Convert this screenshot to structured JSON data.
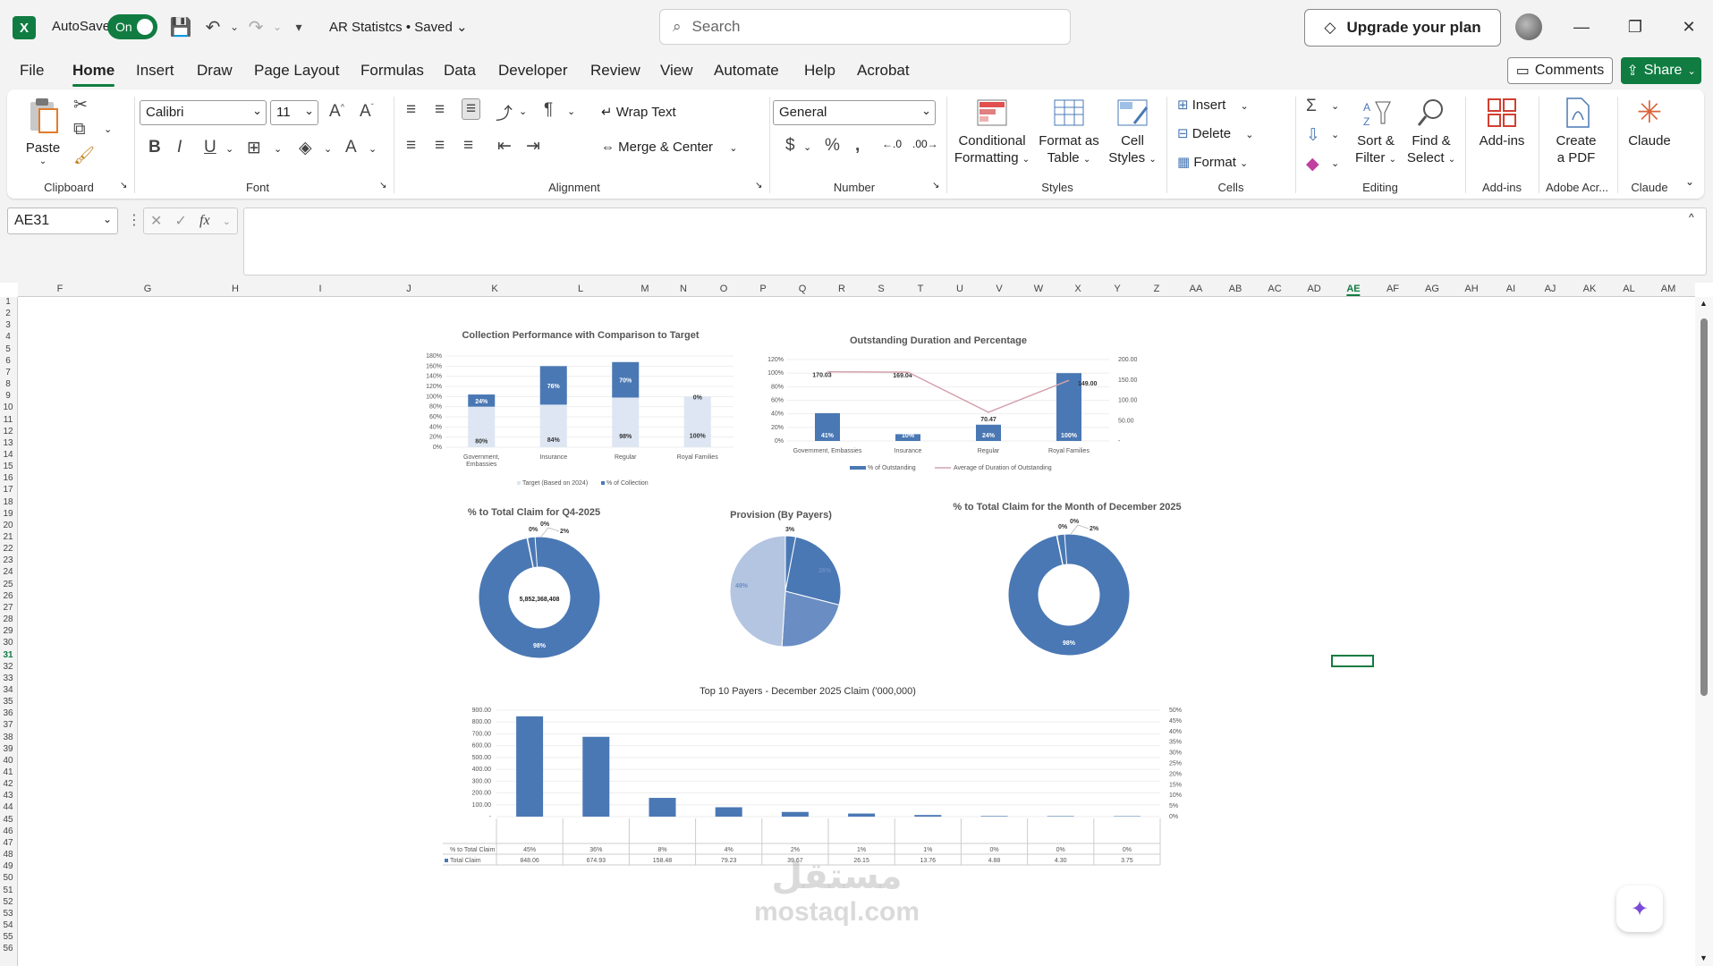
{
  "titlebar": {
    "app_initial": "X",
    "autosave_label": "AutoSave",
    "autosave_state": "On",
    "doc_title": "AR Statistcs • Saved",
    "search_placeholder": "Search",
    "upgrade_label": "Upgrade your plan"
  },
  "menu": {
    "tabs": [
      "File",
      "Home",
      "Insert",
      "Draw",
      "Page Layout",
      "Formulas",
      "Data",
      "Developer",
      "Review",
      "View",
      "Automate",
      "Help",
      "Acrobat"
    ],
    "active": "Home",
    "comments_label": "Comments",
    "share_label": "Share"
  },
  "ribbon": {
    "clipboard": {
      "paste": "Paste",
      "label": "Clipboard"
    },
    "font": {
      "name": "Calibri",
      "size": "11",
      "label": "Font"
    },
    "alignment": {
      "wrap": "Wrap Text",
      "merge": "Merge & Center",
      "label": "Alignment"
    },
    "number": {
      "format": "General",
      "label": "Number"
    },
    "styles": {
      "conditional": [
        "Conditional",
        "Formatting"
      ],
      "format_table": [
        "Format as",
        "Table"
      ],
      "cell_styles": [
        "Cell",
        "Styles"
      ],
      "label": "Styles"
    },
    "cells": {
      "insert": "Insert",
      "delete": "Delete",
      "format": "Format",
      "label": "Cells"
    },
    "editing": {
      "sort": [
        "Sort &",
        "Filter"
      ],
      "find": [
        "Find &",
        "Select"
      ],
      "label": "Editing"
    },
    "addins": {
      "btn": "Add-ins",
      "label": "Add-ins"
    },
    "acrobat": {
      "btn": [
        "Create",
        "a PDF"
      ],
      "label": "Adobe Acr..."
    },
    "claude": {
      "btn": "Claude",
      "label": "Claude"
    }
  },
  "formula_bar": {
    "name_box": "AE31",
    "fx": "fx"
  },
  "grid": {
    "columns": [
      "F",
      "G",
      "H",
      "I",
      "J",
      "K",
      "L",
      "M",
      "N",
      "O",
      "P",
      "Q",
      "R",
      "S",
      "T",
      "U",
      "V",
      "W",
      "X",
      "Y",
      "Z",
      "AA",
      "AB",
      "AC",
      "AD",
      "AE",
      "AF",
      "AG",
      "AH",
      "AI",
      "AJ",
      "AK",
      "AL",
      "AM"
    ],
    "selected_column": "AE",
    "selected_row": "31",
    "rows": [
      "1",
      "2",
      "3",
      "4",
      "5",
      "6",
      "7",
      "8",
      "9",
      "10",
      "11",
      "12",
      "13",
      "14",
      "15",
      "16",
      "17",
      "18",
      "19",
      "20",
      "21",
      "22",
      "23",
      "24",
      "25",
      "26",
      "27",
      "28",
      "29",
      "30",
      "31",
      "32",
      "33",
      "34",
      "35",
      "36",
      "37",
      "38",
      "39",
      "40",
      "41",
      "42",
      "43",
      "44",
      "45",
      "46",
      "47",
      "48",
      "49",
      "50",
      "51",
      "52",
      "53",
      "54",
      "55",
      "56"
    ]
  },
  "chart_data": [
    {
      "type": "bar",
      "title": "Collection Performance with Comparison to Target",
      "categories": [
        "Government, Embassies",
        "Insurance",
        "Regular",
        "Royal Families"
      ],
      "series": [
        {
          "name": "Target (Based on 2024)",
          "values": [
            80,
            84,
            98,
            100
          ]
        },
        {
          "name": "% of Collection",
          "values": [
            24,
            76,
            70,
            0
          ]
        }
      ],
      "y_ticks": [
        "0%",
        "20%",
        "40%",
        "60%",
        "80%",
        "100%",
        "120%",
        "140%",
        "160%",
        "180%"
      ],
      "ylim": [
        0,
        180
      ]
    },
    {
      "type": "bar",
      "title": "Outstanding Duration and Percentage",
      "categories": [
        "Government, Embassies",
        "Insurance",
        "Regular",
        "Royal Families"
      ],
      "series": [
        {
          "name": "% of Outstanding",
          "values": [
            41,
            10,
            24,
            100
          ]
        },
        {
          "name": "Average of Duration of Outstanding",
          "values": [
            170.03,
            169.04,
            70.47,
            149.0
          ]
        }
      ],
      "y_ticks": [
        "0%",
        "20%",
        "40%",
        "60%",
        "80%",
        "100%",
        "120%"
      ],
      "y2_ticks": [
        "-",
        "50.00",
        "100.00",
        "150.00",
        "200.00"
      ],
      "ylim": [
        0,
        120
      ],
      "y2lim": [
        0,
        200
      ]
    },
    {
      "type": "pie",
      "title": "% to Total Claim for Q4-2025",
      "center_label": "5,852,368,408",
      "values": [
        98,
        0,
        0,
        2
      ],
      "labels": [
        "98%",
        "0%",
        "0%",
        "2%"
      ]
    },
    {
      "type": "pie",
      "title": "Provision (By Payers)",
      "values": [
        3,
        26,
        22,
        49
      ],
      "labels": [
        "3%",
        "26%",
        "22%",
        "49%"
      ]
    },
    {
      "type": "pie",
      "title": "% to Total Claim for the Month of December 2025",
      "values": [
        98,
        0,
        0,
        2
      ],
      "labels": [
        "98%",
        "0%",
        "0%",
        "2%"
      ]
    },
    {
      "type": "bar",
      "title": "Top 10 Payers - December 2025 Claim ('000,000)",
      "y_ticks": [
        "-",
        "100.00",
        "200.00",
        "300.00",
        "400.00",
        "500.00",
        "600.00",
        "700.00",
        "800.00",
        "900.00"
      ],
      "y2_ticks": [
        "0%",
        "5%",
        "10%",
        "15%",
        "20%",
        "25%",
        "30%",
        "35%",
        "40%",
        "45%",
        "50%"
      ],
      "ylim": [
        0,
        900
      ],
      "series": [
        {
          "name": "% to Total Claim",
          "labels": [
            "45%",
            "36%",
            "8%",
            "4%",
            "2%",
            "1%",
            "1%",
            "0%",
            "0%",
            "0%"
          ]
        },
        {
          "name": "Total Claim",
          "values": [
            848.06,
            674.93,
            158.48,
            79.23,
            39.67,
            26.15,
            13.76,
            4.88,
            4.3,
            3.75
          ],
          "labels": [
            "848.06",
            "674.93",
            "158.48",
            "79.23",
            "39.67",
            "26.15",
            "13.76",
            "4.88",
            "4.30",
            "3.75"
          ]
        }
      ]
    }
  ],
  "watermark": {
    "arabic": "مستقل",
    "latin": "mostaql.com"
  },
  "colors": {
    "excel_green": "#107c41",
    "bar_dark": "#4a78b4",
    "bar_light": "#dde6f2",
    "line_pink": "#d4a2ae",
    "pie_light": "#b3c5e0"
  }
}
